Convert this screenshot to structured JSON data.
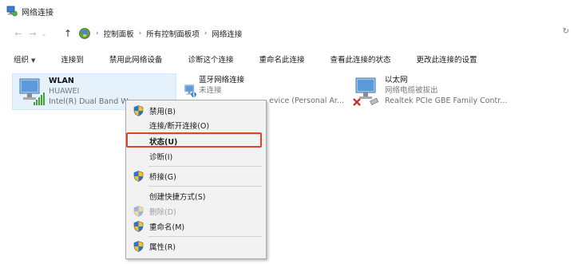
{
  "window": {
    "title": "网络连接"
  },
  "address": {
    "breadcrumb": [
      "控制面板",
      "所有控制面板项",
      "网络连接"
    ],
    "refresh": "↻"
  },
  "toolbar": {
    "organize": "组织",
    "connect_to": "连接到",
    "disable_device": "禁用此网络设备",
    "diagnose": "诊断这个连接",
    "rename": "重命名此连接",
    "view_status": "查看此连接的状态",
    "change_settings": "更改此连接的设置"
  },
  "adapters": [
    {
      "name": "WLAN",
      "sub": "HUAWEI",
      "device": "Intel(R) Dual Band W"
    },
    {
      "name": "蓝牙网络连接",
      "sub": "未连接",
      "device": "evice (Personal Ar..."
    },
    {
      "name": "以太网",
      "sub": "网络电缆被拔出",
      "device": "Realtek PCIe GBE Family Contr..."
    }
  ],
  "context_menu": {
    "disable": "禁用(B)",
    "connect_disconnect": "连接/断开连接(O)",
    "status": "状态(U)",
    "diagnose": "诊断(I)",
    "bridge": "桥接(G)",
    "create_shortcut": "创建快捷方式(S)",
    "delete": "删除(D)",
    "rename": "重命名(M)",
    "properties": "属性(R)"
  },
  "colors": {
    "highlight_border": "#d9462b",
    "selection_bg": "#e5f1fb"
  }
}
